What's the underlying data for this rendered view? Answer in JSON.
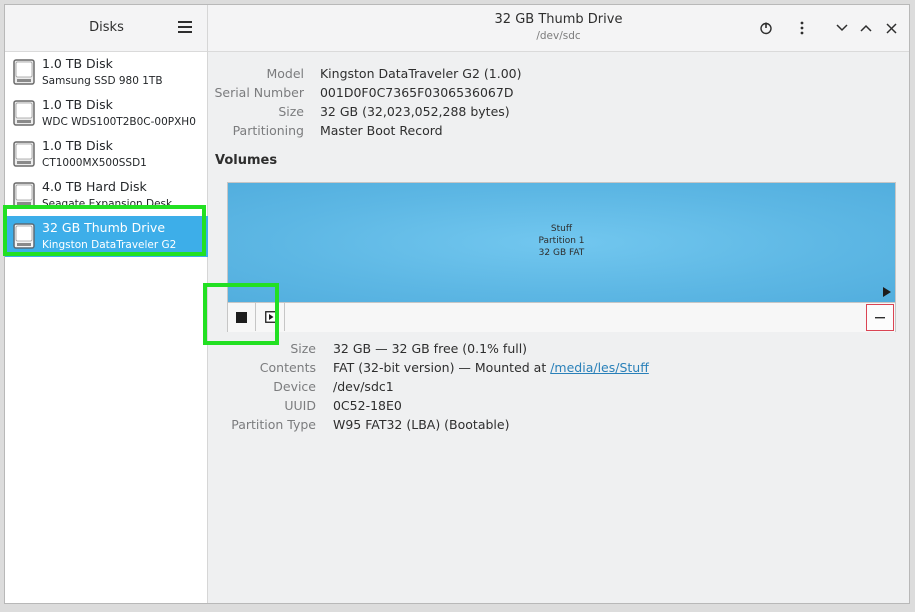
{
  "sidebar": {
    "title": "Disks",
    "menu_icon": "hamburger-menu-icon",
    "disks": [
      {
        "name": "1.0 TB Disk",
        "model": "Samsung SSD 980 1TB",
        "selected": false
      },
      {
        "name": "1.0 TB Disk",
        "model": "WDC WDS100T2B0C-00PXH0",
        "selected": false
      },
      {
        "name": "1.0 TB Disk",
        "model": "CT1000MX500SSD1",
        "selected": false
      },
      {
        "name": "4.0 TB Hard Disk",
        "model": "Seagate Expansion Desk",
        "selected": false
      },
      {
        "name": "32 GB Thumb Drive",
        "model": "Kingston DataTraveler G2",
        "selected": true
      }
    ]
  },
  "header": {
    "title": "32 GB Thumb Drive",
    "subtitle": "/dev/sdc",
    "icons": [
      "power-icon",
      "more-options-icon",
      "chevron-down-icon",
      "chevron-up-icon",
      "close-icon"
    ]
  },
  "drive_info": {
    "model_label": "Model",
    "model_value": "Kingston DataTraveler G2 (1.00)",
    "serial_label": "Serial Number",
    "serial_value": "001D0F0C7365F0306536067D",
    "size_label": "Size",
    "size_value": "32 GB (32,023,052,288 bytes)",
    "partitioning_label": "Partitioning",
    "partitioning_value": "Master Boot Record"
  },
  "volumes": {
    "heading": "Volumes",
    "partition": {
      "name": "Stuff",
      "number": "Partition 1",
      "desc": "32 GB FAT"
    }
  },
  "volume_info": {
    "size_label": "Size",
    "size_value": "32 GB — 32 GB free (0.1% full)",
    "contents_label": "Contents",
    "contents_prefix": "FAT (32-bit version) — Mounted at ",
    "contents_link": "/media/les/Stuff",
    "device_label": "Device",
    "device_value": "/dev/sdc1",
    "uuid_label": "UUID",
    "uuid_value": "0C52-18E0",
    "ptype_label": "Partition Type",
    "ptype_value": "W95 FAT32 (LBA) (Bootable)"
  },
  "colors": {
    "accent": "#3daee9",
    "highlight": "#22e022",
    "partition": "#5db7e4"
  }
}
